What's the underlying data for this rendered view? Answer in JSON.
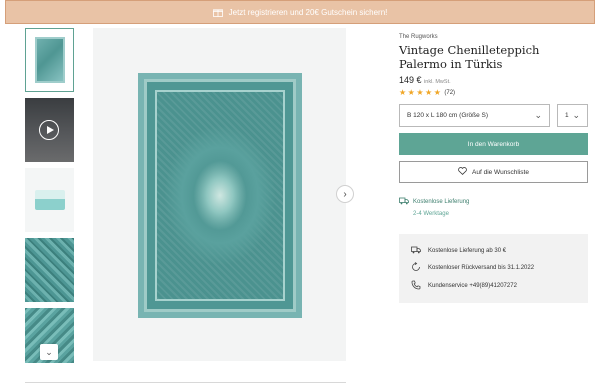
{
  "promo": {
    "text": "Jetzt registrieren und 20€ Gutschein sichern!"
  },
  "product": {
    "brand": "The Rugworks",
    "title": "Vintage Chenilleteppich Palermo in Türkis",
    "price": "149 €",
    "price_note": "inkl. MwSt.",
    "rating_stars": 5,
    "rating_count": "(72)"
  },
  "options": {
    "size": "B 120 x L 180 cm (Größe S)",
    "quantity": "1"
  },
  "buttons": {
    "cart": "In den Warenkorb",
    "wishlist": "Auf die Wunschliste"
  },
  "delivery": {
    "free": "Kostenlose Lieferung",
    "time": "2-4 Werktage"
  },
  "benefits": [
    {
      "icon": "truck-icon",
      "text": "Kostenlose Lieferung ab 30 €"
    },
    {
      "icon": "return-icon",
      "text": "Kostenloser Rückversand bis 31.1.2022"
    },
    {
      "icon": "phone-icon",
      "text": "Kundenservice +49(89)41207272"
    }
  ],
  "gallery": {
    "thumbnails": [
      "rug-flat",
      "video",
      "bedroom",
      "rug-detail-1",
      "rug-detail-2"
    ],
    "play_icon": "play-icon",
    "scroll_icon": "chevron-down-icon",
    "next_icon": "chevron-right-icon"
  },
  "colors": {
    "accent": "#5ea595",
    "promo": "#e9c3a6",
    "star": "#f0a626"
  }
}
